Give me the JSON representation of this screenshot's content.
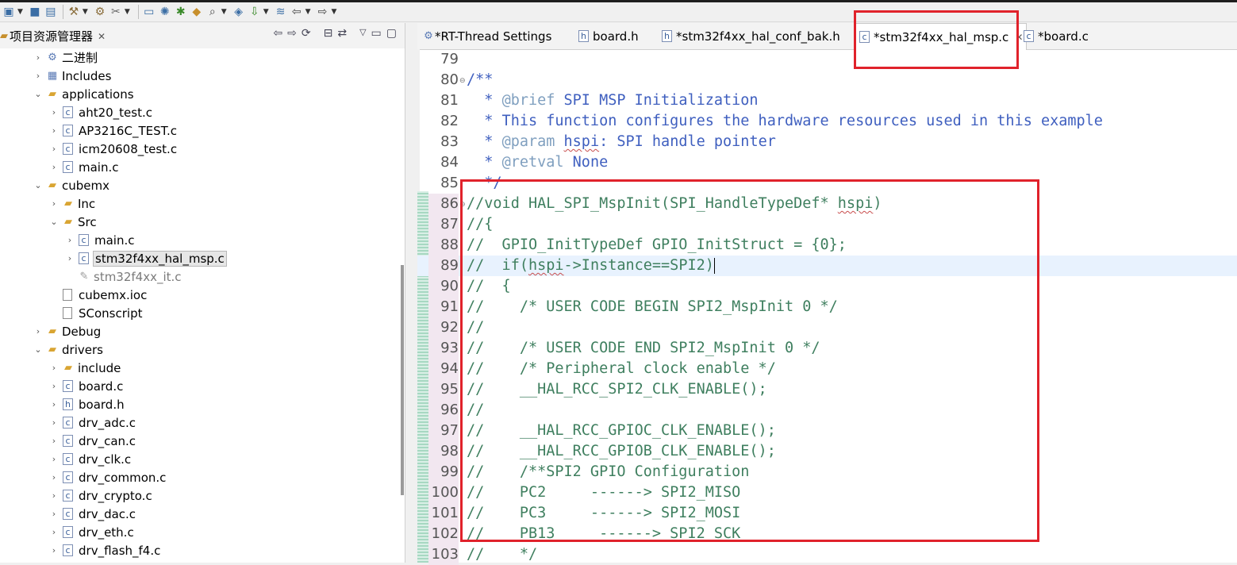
{
  "colors": {
    "accent": "#e0222b",
    "comment": "#3f7f5f",
    "javadoc": "#3f5fbf",
    "doctag": "#7f9fbf"
  },
  "toolbar": {
    "icons": [
      "new-icon",
      "save-icon",
      "save-all-icon",
      "build-icon",
      "hammer-icon",
      "tools-icon",
      "screen-icon",
      "settings-icon",
      "debug-bug-icon",
      "open-icon",
      "search-icon",
      "book-icon",
      "download-icon",
      "layers-icon",
      "nav-back-icon",
      "nav-forward-icon"
    ]
  },
  "explorer": {
    "title": "项目资源管理器",
    "items": [
      {
        "label": "二进制"
      },
      {
        "label": "Includes"
      },
      {
        "label": "applications"
      },
      {
        "label": "aht20_test.c"
      },
      {
        "label": "AP3216C_TEST.c"
      },
      {
        "label": "icm20608_test.c"
      },
      {
        "label": "main.c"
      },
      {
        "label": "cubemx"
      },
      {
        "label": "Inc"
      },
      {
        "label": "Src"
      },
      {
        "label": "main.c"
      },
      {
        "label": "stm32f4xx_hal_msp.c"
      },
      {
        "label": "stm32f4xx_it.c"
      },
      {
        "label": "cubemx.ioc"
      },
      {
        "label": "SConscript"
      },
      {
        "label": "Debug"
      },
      {
        "label": "drivers"
      },
      {
        "label": "include"
      },
      {
        "label": "board.c"
      },
      {
        "label": "board.h"
      },
      {
        "label": "drv_adc.c"
      },
      {
        "label": "drv_can.c"
      },
      {
        "label": "drv_clk.c"
      },
      {
        "label": "drv_common.c"
      },
      {
        "label": "drv_crypto.c"
      },
      {
        "label": "drv_dac.c"
      },
      {
        "label": "drv_eth.c"
      },
      {
        "label": "drv_flash_f4.c"
      }
    ]
  },
  "tabs": [
    {
      "label": "*RT-Thread Settings"
    },
    {
      "label": "board.h"
    },
    {
      "label": "*stm32f4xx_hal_conf_bak.h"
    },
    {
      "label": "*stm32f4xx_hal_msp.c"
    },
    {
      "label": "*board.c"
    }
  ],
  "code": {
    "line_numbers": [
      "79",
      "80",
      "81",
      "82",
      "83",
      "84",
      "85",
      "86",
      "87",
      "88",
      "89",
      "90",
      "91",
      "92",
      "93",
      "94",
      "95",
      "96",
      "97",
      "98",
      "99",
      "100",
      "101",
      "102",
      "103"
    ],
    "l80": "/**",
    "l81a": "  * ",
    "l81b": "@brief",
    "l81c": " SPI MSP Initialization",
    "l82": "  * This function configures the hardware resources used in this example",
    "l83a": "  * ",
    "l83b": "@param",
    "l83c": " ",
    "l83d": "hspi",
    "l83e": ": SPI handle pointer",
    "l84a": "  * ",
    "l84b": "@retval",
    "l84c": " None",
    "l85": "  */",
    "l86a": "//void HAL_SPI_MspInit(SPI_HandleTypeDef* ",
    "l86b": "hspi",
    "l86c": ")",
    "l87": "//{",
    "l88": "//  GPIO_InitTypeDef GPIO_InitStruct = {0};",
    "l89a": "//  if(",
    "l89b": "hspi",
    "l89c": "->Instance==SPI2)",
    "l90": "//  {",
    "l91": "//    /* USER CODE BEGIN SPI2_MspInit 0 */",
    "l92": "//",
    "l93": "//    /* USER CODE END SPI2_MspInit 0 */",
    "l94": "//    /* Peripheral clock enable */",
    "l95": "//    __HAL_RCC_SPI2_CLK_ENABLE();",
    "l96": "//",
    "l97": "//    __HAL_RCC_GPIOC_CLK_ENABLE();",
    "l98": "//    __HAL_RCC_GPIOB_CLK_ENABLE();",
    "l99": "//    /**SPI2 GPIO Configuration",
    "l100": "//    PC2     ------> SPI2_MISO",
    "l101": "//    PC3     ------> SPI2_MOSI",
    "l102": "//    PB13     ------> SPI2_SCK",
    "l103": "//    */"
  }
}
